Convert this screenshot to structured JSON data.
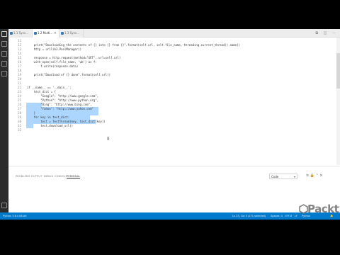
{
  "tabs": [
    {
      "label": "1.1 Sync..."
    },
    {
      "label": "1.2 Multi..."
    },
    {
      "label": "1.3 Sync..."
    }
  ],
  "tab_actions": "⧉ ◫ ⋯",
  "editor": {
    "lines": [
      {
        "n": "11",
        "text": ""
      },
      {
        "n": "12",
        "text": "    print(\"Downloading the contents of {} into {} from {}\".format(self.url, self.file_name, threading.current_thread().name))"
      },
      {
        "n": "13",
        "text": "    http = urllib3.PoolManager()"
      },
      {
        "n": "14",
        "text": ""
      },
      {
        "n": "15",
        "text": "    response = http.request(method=\"GET\", url=self.url)"
      },
      {
        "n": "16",
        "text": "    with open(self.file_name, 'wb') as f:"
      },
      {
        "n": "17",
        "text": "        f.write(response.data)"
      },
      {
        "n": "18",
        "text": ""
      },
      {
        "n": "19",
        "text": "    print(\"Download of {} done\".format(self.url))"
      },
      {
        "n": "20",
        "text": ""
      },
      {
        "n": "21",
        "text": ""
      },
      {
        "n": "22",
        "text": "if __name__ == '__main__':"
      },
      {
        "n": "23",
        "text": "    test_dict = {"
      },
      {
        "n": "24",
        "text": "        \"Google\": \"http://www.google.com\","
      },
      {
        "n": "25",
        "text": "        \"Python\": \"http://www.python.org\","
      },
      {
        "n": "26",
        "text": "        \"Bing\": \"http://www.bing.com\","
      },
      {
        "n": "27",
        "text": "        \"Yahoo\": \"http://www.yahoo.com\""
      },
      {
        "n": "28",
        "text": "    }"
      },
      {
        "n": "29",
        "text": "    for key in test_dict:"
      },
      {
        "n": "30",
        "text": "        test = TestThread(key, test_dict[key])"
      },
      {
        "n": "31",
        "text": "        test.download_url()"
      },
      {
        "n": "32",
        "text": ""
      }
    ]
  },
  "panel": {
    "tabs": [
      "PROBLEMS",
      "OUTPUT",
      "DEBUG CONSOLE",
      "TERMINAL"
    ],
    "select_value": "Code",
    "icons": "≡ 🔒 ⌃ ✕"
  },
  "status": {
    "left": "Python 3.6.4 64-bit",
    "cursor": "Ln 23, Col 5 (171 selected)",
    "spaces": "Spaces: 4",
    "encoding": "UTF-8",
    "eol": "LF",
    "language": "Python",
    "bell": "🔔"
  },
  "watermark": "Packt>"
}
